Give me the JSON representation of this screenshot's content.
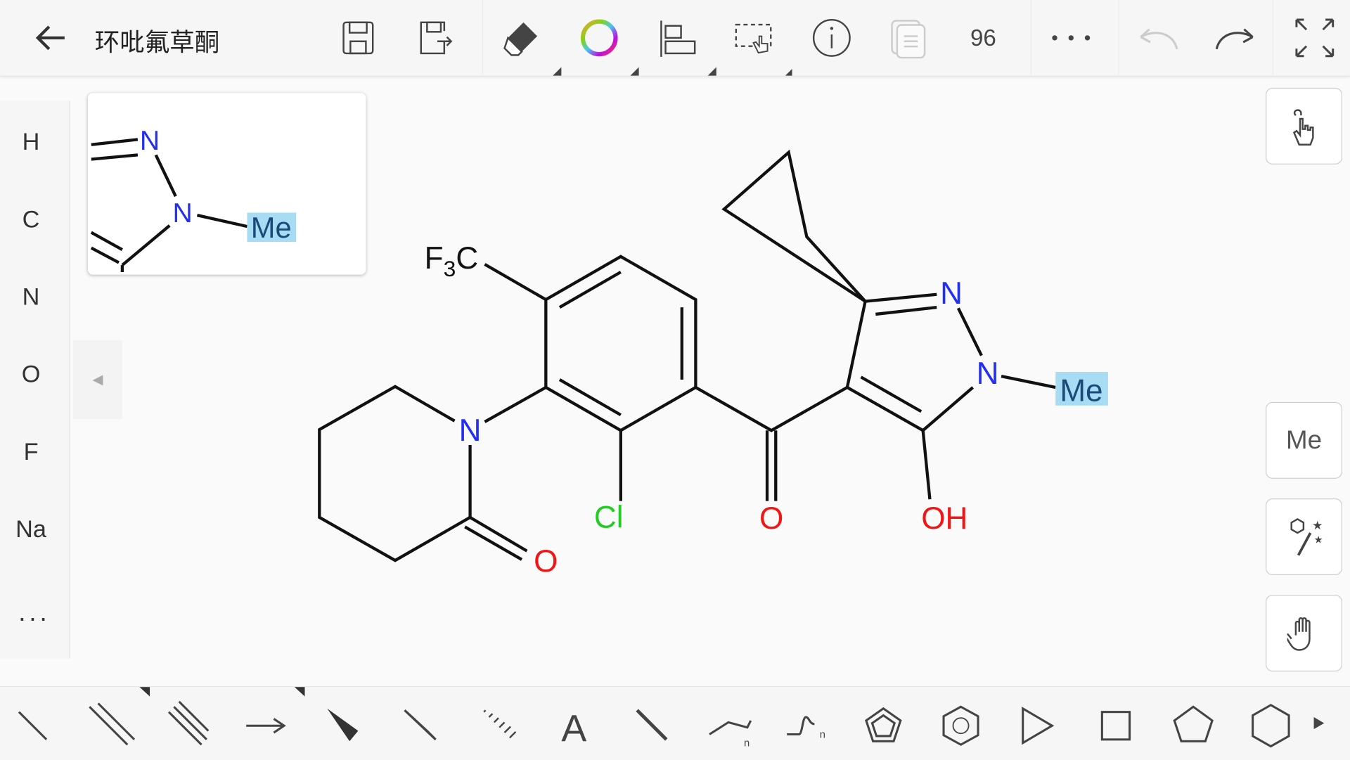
{
  "header": {
    "title": "环吡氟草酮",
    "zoom": "96"
  },
  "elements": [
    "H",
    "C",
    "N",
    "O",
    "F",
    "Na",
    "..."
  ],
  "right_panel": {
    "me_label": "Me"
  },
  "molecule": {
    "atoms": {
      "n_ring": "N",
      "o_lactam": "O",
      "cl": "Cl",
      "o_ketone": "O",
      "n2": "N",
      "n1": "N",
      "me": "Me",
      "oh": "OH",
      "f3c_f": "F",
      "f3c_3": "3",
      "f3c_c": "C"
    },
    "colors": {
      "N": "#2430f0",
      "O": "#f01616",
      "Cl": "#22cc22",
      "C": "#111111",
      "highlight": "#a8dcf5"
    }
  },
  "preview": {
    "n_top": "N",
    "n_mid": "N",
    "me": "Me"
  },
  "bottom_tools": [
    "single-bond",
    "double-bond",
    "triple-bond",
    "arrow",
    "wedge-bond",
    "hollow-wedge-bond",
    "hash-bond",
    "text",
    "bold-bond",
    "chain",
    "wavy-chain",
    "cyclopentadiene",
    "benzene",
    "triangle",
    "square",
    "pentagon",
    "hexagon",
    "more"
  ]
}
